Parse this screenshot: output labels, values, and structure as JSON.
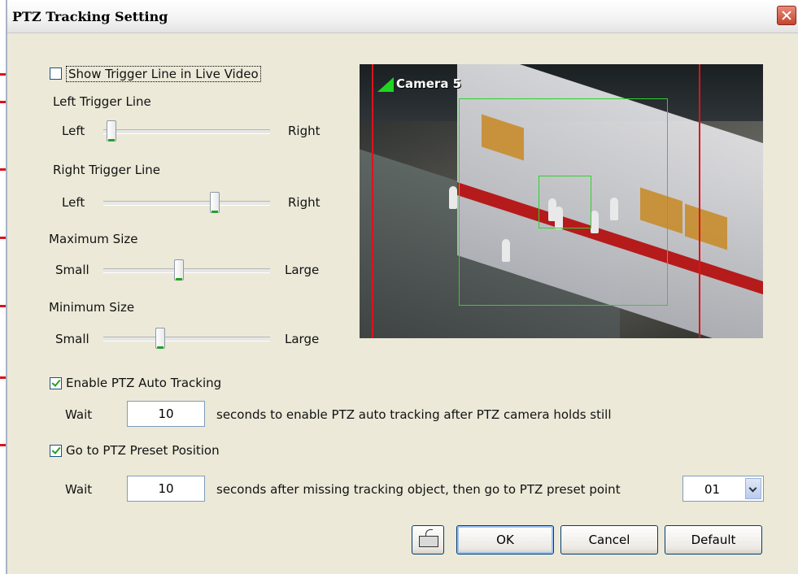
{
  "window": {
    "title": "PTZ Tracking Setting"
  },
  "trigger": {
    "show_label": "Show Trigger Line in Live Video",
    "left_line_label": "Left Trigger Line",
    "right_line_label": "Right Trigger Line",
    "left_word": "Left",
    "right_word": "Right",
    "left_value": 0.02,
    "right_value": 0.68
  },
  "size": {
    "max_label": "Maximum Size",
    "min_label": "Minimum Size",
    "small_word": "Small",
    "large_word": "Large",
    "max_value": 0.45,
    "min_value": 0.33
  },
  "auto_tracking": {
    "label": "Enable PTZ Auto Tracking",
    "checked": true,
    "wait_label": "Wait",
    "wait_value": "10",
    "description": "seconds to enable PTZ auto tracking after PTZ camera holds still"
  },
  "preset": {
    "label": "Go to PTZ Preset Position",
    "checked": true,
    "wait_label": "Wait",
    "wait_value": "10",
    "description": "seconds after missing tracking object, then go to PTZ preset point",
    "point": "01"
  },
  "video": {
    "camera_label": "Camera 5"
  },
  "buttons": {
    "ok": "OK",
    "cancel": "Cancel",
    "default": "Default"
  },
  "icons": {
    "close": "close-icon",
    "keyboard": "keyboard-icon",
    "dropdown": "chevron-down-icon"
  },
  "colors": {
    "callout": "#d7141c",
    "trigger_line": "#e0121b",
    "tracking_box": "#2fd12f"
  }
}
